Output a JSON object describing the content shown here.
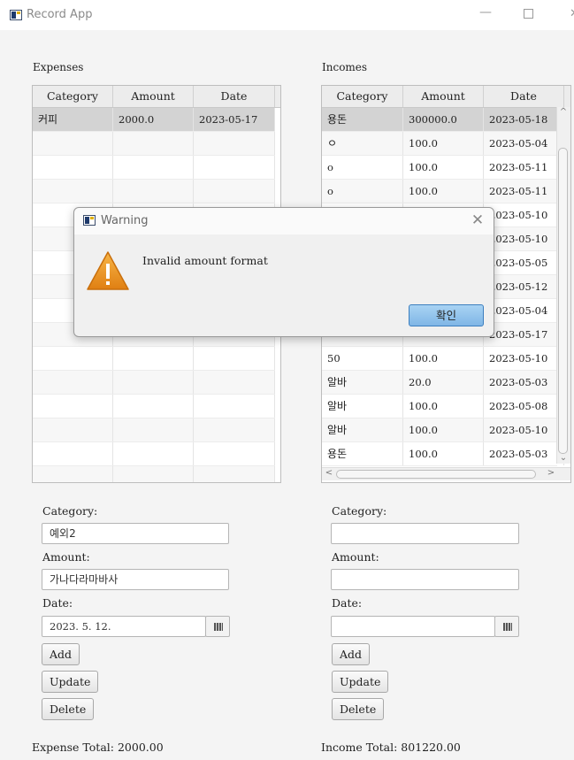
{
  "window": {
    "title": "Record App",
    "minimize_glyph": "—"
  },
  "expenses": {
    "label": "Expenses",
    "columns": [
      "Category",
      "Amount",
      "Date"
    ],
    "rows": [
      {
        "category": "커피",
        "amount": "2000.0",
        "date": "2023-05-17",
        "selected": true
      }
    ],
    "empty_rows": 15
  },
  "incomes": {
    "label": "Incomes",
    "columns": [
      "Category",
      "Amount",
      "Date"
    ],
    "rows": [
      {
        "category": "용돈",
        "amount": "300000.0",
        "date": "2023-05-18",
        "selected": true
      },
      {
        "category": "ㅇ",
        "amount": "100.0",
        "date": "2023-05-04"
      },
      {
        "category": "o",
        "amount": "100.0",
        "date": "2023-05-11"
      },
      {
        "category": "o",
        "amount": "100.0",
        "date": "2023-05-11"
      },
      {
        "category": "",
        "amount": "",
        "date": "2023-05-10"
      },
      {
        "category": "",
        "amount": "",
        "date": "2023-05-10"
      },
      {
        "category": "",
        "amount": "",
        "date": "2023-05-05"
      },
      {
        "category": "",
        "amount": "",
        "date": "2023-05-12"
      },
      {
        "category": "",
        "amount": "",
        "date": "2023-05-04"
      },
      {
        "category": "",
        "amount": "",
        "date": "2023-05-17"
      },
      {
        "category": "50",
        "amount": "100.0",
        "date": "2023-05-10"
      },
      {
        "category": "알바",
        "amount": "20.0",
        "date": "2023-05-03"
      },
      {
        "category": "알바",
        "amount": "100.0",
        "date": "2023-05-08"
      },
      {
        "category": "알바",
        "amount": "100.0",
        "date": "2023-05-10"
      },
      {
        "category": "용돈",
        "amount": "100.0",
        "date": "2023-05-03"
      }
    ]
  },
  "expense_form": {
    "category_label": "Category:",
    "category_value": "예외2",
    "amount_label": "Amount:",
    "amount_value": "가나다라마바사",
    "date_label": "Date:",
    "date_value": "2023. 5. 12.",
    "add": "Add",
    "update": "Update",
    "delete": "Delete",
    "total": "Expense Total: 2000.00"
  },
  "income_form": {
    "category_label": "Category:",
    "category_value": "",
    "amount_label": "Amount:",
    "amount_value": "",
    "date_label": "Date:",
    "date_value": "",
    "add": "Add",
    "update": "Update",
    "delete": "Delete",
    "total": "Income Total: 801220.00"
  },
  "dialog": {
    "title": "Warning",
    "message": "Invalid amount format",
    "ok": "확인",
    "icon": "warning-icon"
  },
  "colors": {
    "selected_row": "#d3d3d3",
    "dialog_ok": "#7fb6e6",
    "warning": "#e8931a"
  }
}
